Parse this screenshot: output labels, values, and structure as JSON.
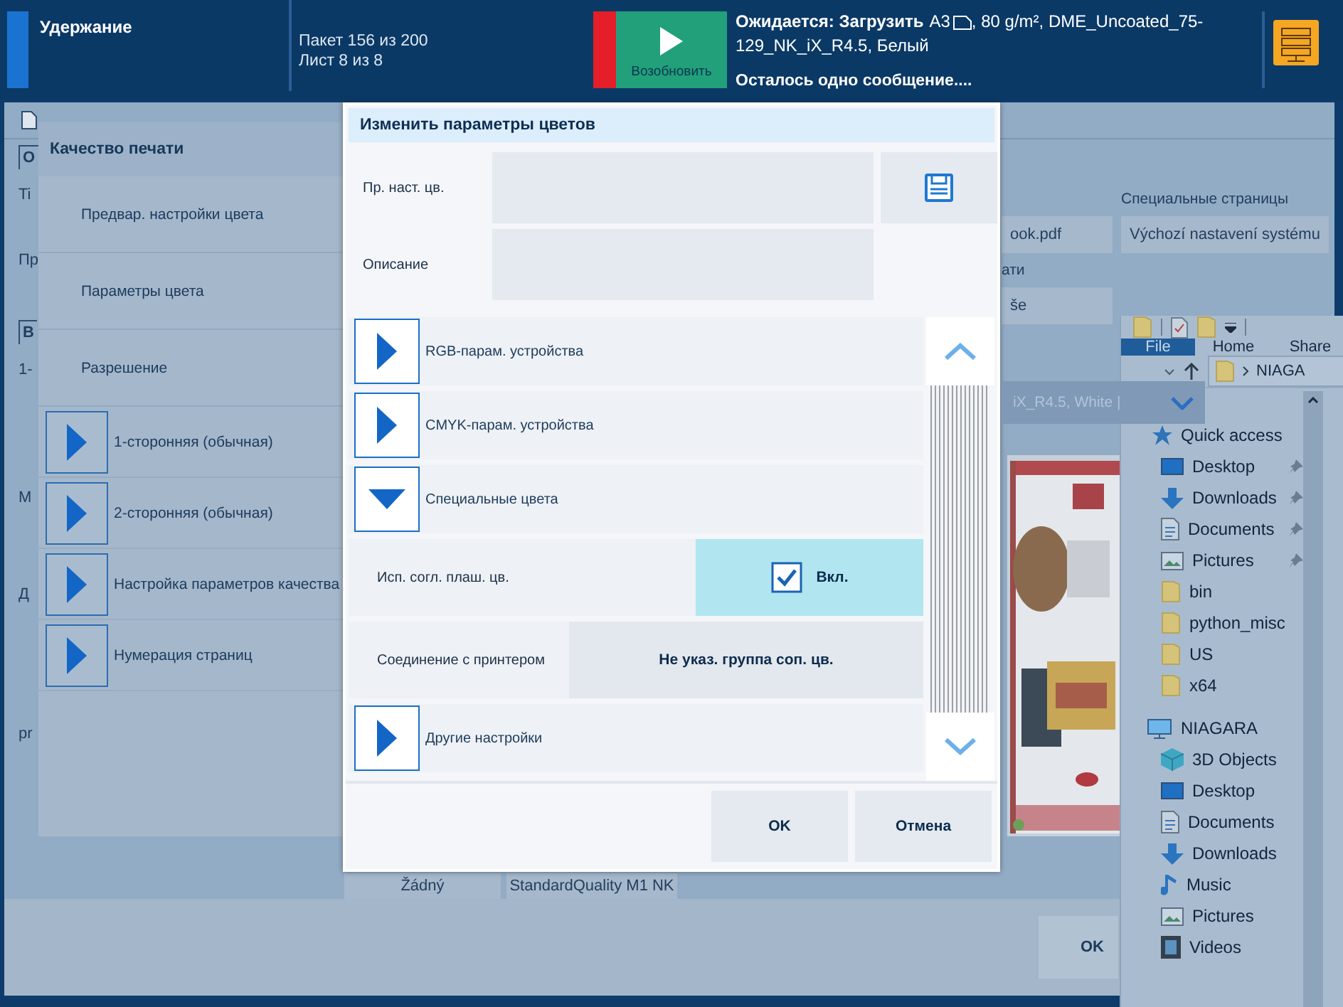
{
  "top_bar": {
    "job_state": "Удержание",
    "batch": "Пакет 156 из 200",
    "sheet": "Лист 8 из 8",
    "resume_button": "Возобновить",
    "status": {
      "label": "Ожидается: Загрузить",
      "size": "A3",
      "details": ", 80 g/m², DME_Uncoated_75-",
      "details_line2": "129_NK_iX_R4.5, Белый"
    },
    "message": "Осталось одно сообщение...."
  },
  "job_form": {
    "left_labels": [
      {
        "kind": "tab",
        "label": "О"
      },
      {
        "kind": "label",
        "label": "Ti"
      },
      {
        "kind": "label",
        "label": "Пр"
      },
      {
        "kind": "tab",
        "label": "В"
      },
      {
        "kind": "label",
        "label": "1-"
      },
      {
        "kind": "label",
        "label": "М"
      },
      {
        "kind": "label",
        "label": "Д"
      },
      {
        "kind": "label",
        "label": "pr"
      }
    ],
    "file_field": "ook.pdf",
    "print_label": "ати",
    "mode_field": "še",
    "special_pages": {
      "label": "Специальные страницы",
      "value": "Výchozí nastavení systému"
    },
    "media_bar": "iX_R4.5, White |",
    "bottom_fields": [
      "Žádný",
      "StandardQuality M1 NK"
    ],
    "ok_button": "OK"
  },
  "quality_panel": {
    "title": "Качество печати",
    "items": [
      {
        "kind": "text",
        "label": "Предвар. настройки цвета"
      },
      {
        "kind": "text",
        "label": "Параметры цвета"
      },
      {
        "kind": "text",
        "label": "Разрешение"
      },
      {
        "kind": "expander",
        "label": "1-сторонняя (обычная)",
        "expanded": false
      },
      {
        "kind": "expander",
        "label": "2-сторонняя (обычная)",
        "expanded": false
      },
      {
        "kind": "expander",
        "label": "Настройка параметров качества",
        "expanded": false
      },
      {
        "kind": "expander",
        "label": "Нумерация страниц",
        "expanded": false
      }
    ]
  },
  "dialog": {
    "title": "Изменить параметры цветов",
    "preset_label": "Пр. наст. цв.",
    "description_label": "Описание",
    "sections": [
      {
        "kind": "expander",
        "label": "RGB-парам. устройства",
        "expanded": false
      },
      {
        "kind": "expander",
        "label": "CMYK-парам. устройства",
        "expanded": false
      },
      {
        "kind": "expander",
        "label": "Специальные цвета",
        "expanded": true
      },
      {
        "kind": "checkbox",
        "label": "Исп. согл. плаш. цв.",
        "value": "Вкл.",
        "checked": true
      },
      {
        "kind": "choice",
        "label": "Соединение с принтером",
        "value": "Не указ. группа соп. цв."
      },
      {
        "kind": "expander",
        "label": "Другие настройки",
        "expanded": false
      }
    ],
    "buttons": [
      "OK",
      "Отмена"
    ]
  },
  "explorer": {
    "ribbon_tabs": [
      {
        "label": "File",
        "selected": true
      },
      {
        "label": "Home",
        "selected": false
      },
      {
        "label": "Share",
        "selected": false
      }
    ],
    "address": "NIAGA",
    "nav": [
      {
        "kind": "quick",
        "label": "Quick access",
        "children": [
          {
            "kind": "desktop",
            "label": "Desktop",
            "pinned": true
          },
          {
            "kind": "downloads",
            "label": "Downloads",
            "pinned": true
          },
          {
            "kind": "documents",
            "label": "Documents",
            "pinned": true
          },
          {
            "kind": "pictures",
            "label": "Pictures",
            "pinned": true
          },
          {
            "kind": "folder",
            "label": "bin",
            "pinned": false
          },
          {
            "kind": "folder",
            "label": "python_misc",
            "pinned": false
          },
          {
            "kind": "folder",
            "label": "US",
            "pinned": false
          },
          {
            "kind": "folder",
            "label": "x64",
            "pinned": false
          }
        ]
      },
      {
        "kind": "computer",
        "label": "NIAGARA",
        "children": [
          {
            "kind": "objects3d",
            "label": "3D Objects",
            "pinned": false
          },
          {
            "kind": "desktop",
            "label": "Desktop",
            "pinned": false
          },
          {
            "kind": "documents",
            "label": "Documents",
            "pinned": false
          },
          {
            "kind": "downloads",
            "label": "Downloads",
            "pinned": false
          },
          {
            "kind": "music",
            "label": "Music",
            "pinned": false
          },
          {
            "kind": "pictures",
            "label": "Pictures",
            "pinned": false
          },
          {
            "kind": "videos",
            "label": "Videos",
            "pinned": false
          }
        ]
      }
    ]
  }
}
